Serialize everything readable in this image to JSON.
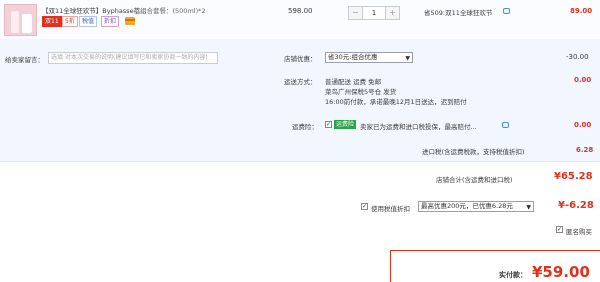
{
  "item": {
    "title_tag": "【双11全球狂欢节】",
    "title_text": "Byphasse蓓...",
    "package_label": "组合套餐：",
    "package_value": "(500ml)*2",
    "badge_double11": "双11",
    "badge_installment": "5折",
    "badge_tax": "税值",
    "badge_discount": "折扣",
    "unit_price": "598.00",
    "quantity": "1",
    "qty_minus": "−",
    "qty_plus": "+",
    "savings": "省509:双11全球狂欢节",
    "subtotal": "89.00"
  },
  "message": {
    "label": "给卖家留言：",
    "placeholder": "选填:对本次交易的说明(建议填写已和卖家协商一致的内容)"
  },
  "shop_discount": {
    "label": "店铺优惠：",
    "selected": "省30元:组合优惠",
    "amount": "-30.00"
  },
  "shipping": {
    "label": "运送方式：",
    "method_line": "普通配送 运费 免邮",
    "warehouse_line": "菜鸟广州保税5号仓  发货",
    "eta_line": "16:00前付款，承诺最晚12月1日送达，迟到赔付",
    "amount": "0.00"
  },
  "insurance": {
    "label": "运费险：",
    "badge": "运费险",
    "text": "卖家已为运费和进口税投保，最高赔付...",
    "amount": "0.00"
  },
  "import_tax": {
    "label": "进口税(含运费税款，支持税值折扣)",
    "amount": "6.28"
  },
  "shop_total": {
    "label": "店铺合计(含运费和进口税)",
    "amount": "¥65.28"
  },
  "tax_discount": {
    "label": "使用税值折扣",
    "selected": "最高优惠200元，已优惠6.28元",
    "amount": "¥-6.28"
  },
  "anonymous": {
    "label": "匿名购买"
  },
  "payment": {
    "label": "实付款：",
    "amount": "¥59.00"
  },
  "colors": {
    "accent_red": "#e0301e",
    "insurance_green": "#2aa34a",
    "promo_bg": "#f2f7ff"
  }
}
